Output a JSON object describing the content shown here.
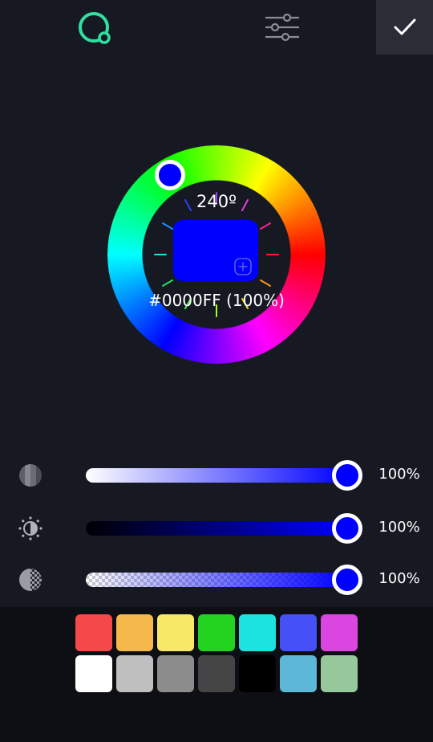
{
  "header": {
    "tabs": [
      {
        "name": "wheel",
        "icon": "color-wheel-icon",
        "active": true,
        "color": "#2fe0a0"
      },
      {
        "name": "sliders",
        "icon": "sliders-icon",
        "active": false,
        "color": "#8a8d96"
      }
    ],
    "confirm_icon": "checkmark-icon"
  },
  "picker": {
    "hue_label": "240º",
    "hex_label": "#0000FF (100%)",
    "current_color": "#0000FF",
    "hue": 240
  },
  "sliders": [
    {
      "id": "saturation",
      "icon": "saturation-icon",
      "value": 1.0,
      "label": "100%"
    },
    {
      "id": "brightness",
      "icon": "brightness-icon",
      "value": 1.0,
      "label": "100%"
    },
    {
      "id": "opacity",
      "icon": "opacity-icon",
      "value": 1.0,
      "label": "100%"
    }
  ],
  "palette": {
    "row1": [
      "#f54848",
      "#f5b84a",
      "#f8e868",
      "#22d31f",
      "#1de3df",
      "#4650f7",
      "#db46e0"
    ],
    "row2": [
      "#ffffff",
      "#bfbfbf",
      "#8c8c8c",
      "#454545",
      "#000000",
      "#5db8d8",
      "#97c89c"
    ]
  }
}
